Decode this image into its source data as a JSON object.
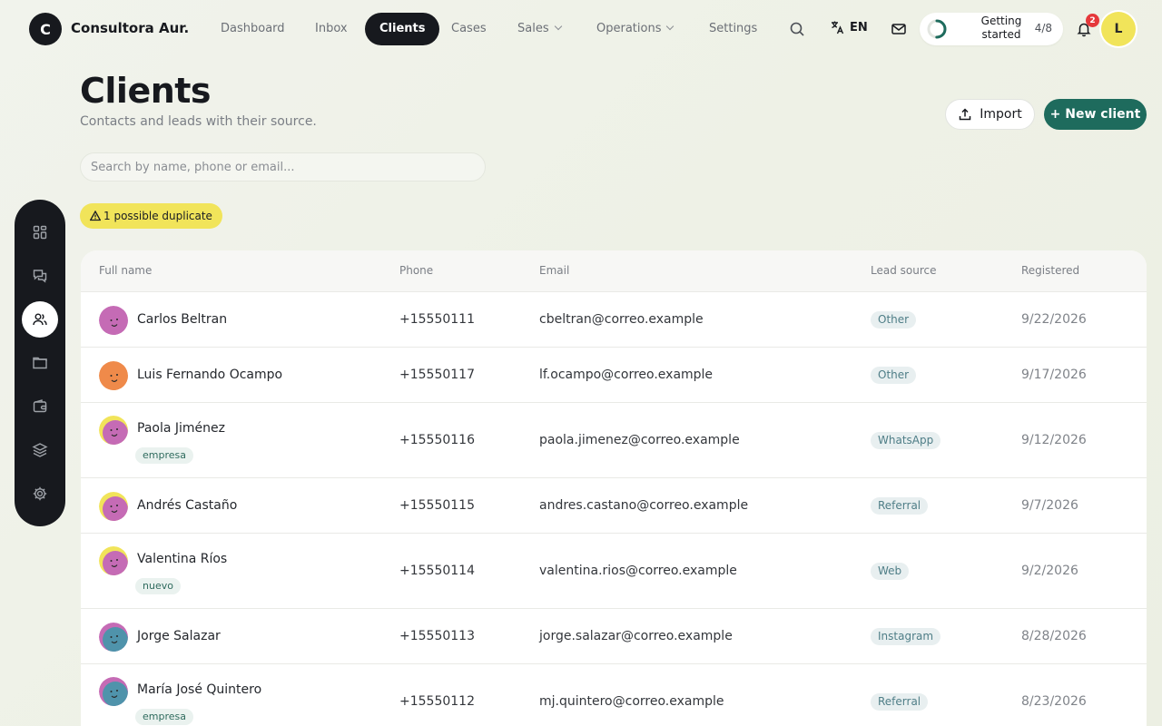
{
  "brand": {
    "initial": "C",
    "name": "Consultora Aur..."
  },
  "nav": {
    "dashboard": "Dashboard",
    "inbox": "Inbox",
    "clients": "Clients",
    "cases": "Cases",
    "sales": "Sales",
    "operations": "Operations",
    "settings": "Settings"
  },
  "language": "EN",
  "getting_started": {
    "label": "Getting started",
    "count": "4/8",
    "progress": 0.5
  },
  "notifications": {
    "count": "2"
  },
  "user": {
    "initial": "L"
  },
  "page": {
    "title": "Clients",
    "subtitle": "Contacts and leads with their source.",
    "import_label": "Import",
    "new_label": "+ New client",
    "search_placeholder": "Search by name, phone or email...",
    "duplicate_notice": "1 possible duplicate"
  },
  "table": {
    "headers": {
      "name": "Full name",
      "phone": "Phone",
      "email": "Email",
      "source": "Lead source",
      "registered": "Registered"
    },
    "rows": [
      {
        "name": "Carlos Beltran",
        "phone": "+15550111",
        "email": "cbeltran@correo.example",
        "source": "Other",
        "registered": "9/22/2026",
        "tag": "",
        "avatar_color": "#c56bb5",
        "avatar_accent": "#c56bb5"
      },
      {
        "name": "Luis Fernando Ocampo",
        "phone": "+15550117",
        "email": "lf.ocampo@correo.example",
        "source": "Other",
        "registered": "9/17/2026",
        "tag": "",
        "avatar_color": "#ef8a4a",
        "avatar_accent": "#ef8a4a"
      },
      {
        "name": "Paola Jiménez",
        "phone": "+15550116",
        "email": "paola.jimenez@correo.example",
        "source": "WhatsApp",
        "registered": "9/12/2026",
        "tag": "empresa",
        "avatar_color": "#c56bb5",
        "avatar_accent": "#f1e45a"
      },
      {
        "name": "Andrés Castaño",
        "phone": "+15550115",
        "email": "andres.castano@correo.example",
        "source": "Referral",
        "registered": "9/7/2026",
        "tag": "",
        "avatar_color": "#c56bb5",
        "avatar_accent": "#f1e45a"
      },
      {
        "name": "Valentina Ríos",
        "phone": "+15550114",
        "email": "valentina.rios@correo.example",
        "source": "Web",
        "registered": "9/2/2026",
        "tag": "nuevo",
        "avatar_color": "#c56bb5",
        "avatar_accent": "#f1e45a"
      },
      {
        "name": "Jorge Salazar",
        "phone": "+15550113",
        "email": "jorge.salazar@correo.example",
        "source": "Instagram",
        "registered": "8/28/2026",
        "tag": "",
        "avatar_color": "#4f93ab",
        "avatar_accent": "#c56bb5"
      },
      {
        "name": "María José Quintero",
        "phone": "+15550112",
        "email": "mj.quintero@correo.example",
        "source": "Referral",
        "registered": "8/23/2026",
        "tag": "empresa",
        "avatar_color": "#4f93ab",
        "avatar_accent": "#c56bb5"
      }
    ]
  },
  "colors": {
    "accent": "#1e6b5d",
    "highlight": "#f1e45a",
    "dark": "#17191e"
  }
}
